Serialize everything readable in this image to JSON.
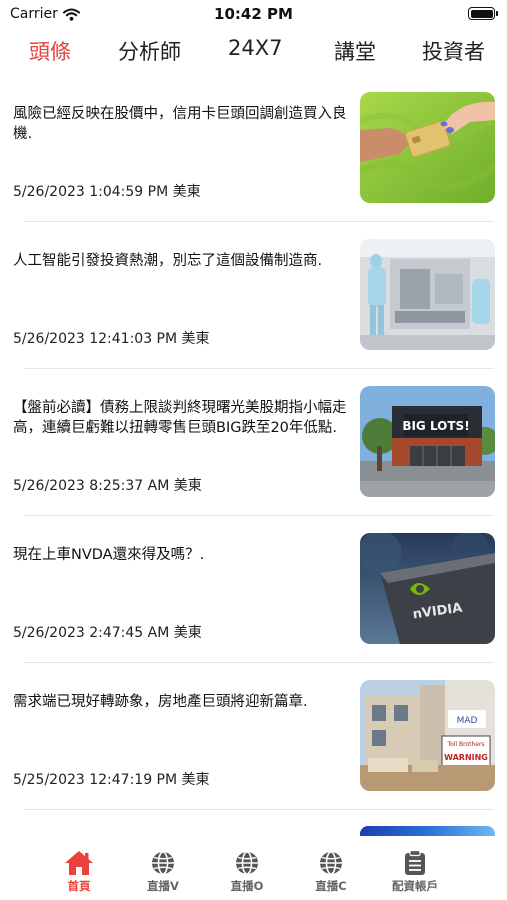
{
  "status_bar": {
    "carrier": "Carrier",
    "time": "10:42 PM",
    "icons": [
      "wifi-icon",
      "battery-icon"
    ]
  },
  "top_tabs": [
    {
      "label": "頭條",
      "active": true
    },
    {
      "label": "分析師",
      "active": false
    },
    {
      "label": "24X7",
      "active": false
    },
    {
      "label": "講堂",
      "active": false
    },
    {
      "label": "投資者",
      "active": false
    }
  ],
  "news": [
    {
      "title": "風險已經反映在股價中，信用卡巨頭回調創造買入良機.",
      "time": "5/26/2023 1:04:59 PM 美東",
      "image": "credit-card-handoff-photo"
    },
    {
      "title": "人工智能引發投資熱潮，別忘了這個設備制造商.",
      "time": "5/26/2023 12:41:03 PM 美東",
      "image": "cleanroom-equipment-photo"
    },
    {
      "title": "【盤前必讀】債務上限談判終現曙光美股期指小幅走高，連續巨虧難以扭轉零售巨頭BIG跌至20年低點.",
      "time": "5/26/2023 8:25:37 AM 美東",
      "image": "big-lots-storefront-photo",
      "image_text": "BIG LOTS!"
    },
    {
      "title": "現在上車NVDA還來得及嗎？.",
      "time": "5/26/2023 2:47:45 AM 美東",
      "image": "nvidia-sign-photo",
      "image_text": "nVIDIA"
    },
    {
      "title": "需求端已現好轉跡象，房地產巨頭將迎新篇章.",
      "time": "5/25/2023 12:47:19 PM 美東",
      "image": "housing-construction-photo",
      "image_text": "WARNING"
    }
  ],
  "bottom_tabs": [
    {
      "label": "首頁",
      "icon": "home-icon",
      "active": true
    },
    {
      "label": "直播V",
      "icon": "globe-icon",
      "active": false
    },
    {
      "label": "直播O",
      "icon": "globe-icon",
      "active": false
    },
    {
      "label": "直播C",
      "icon": "globe-icon",
      "active": false
    },
    {
      "label": "配資帳戶",
      "icon": "clipboard-icon",
      "active": false
    }
  ],
  "colors": {
    "accent": "#e8423a",
    "inactive_label": "#666666",
    "icon_gray": "#555555",
    "divider": "#e6e6e6"
  }
}
